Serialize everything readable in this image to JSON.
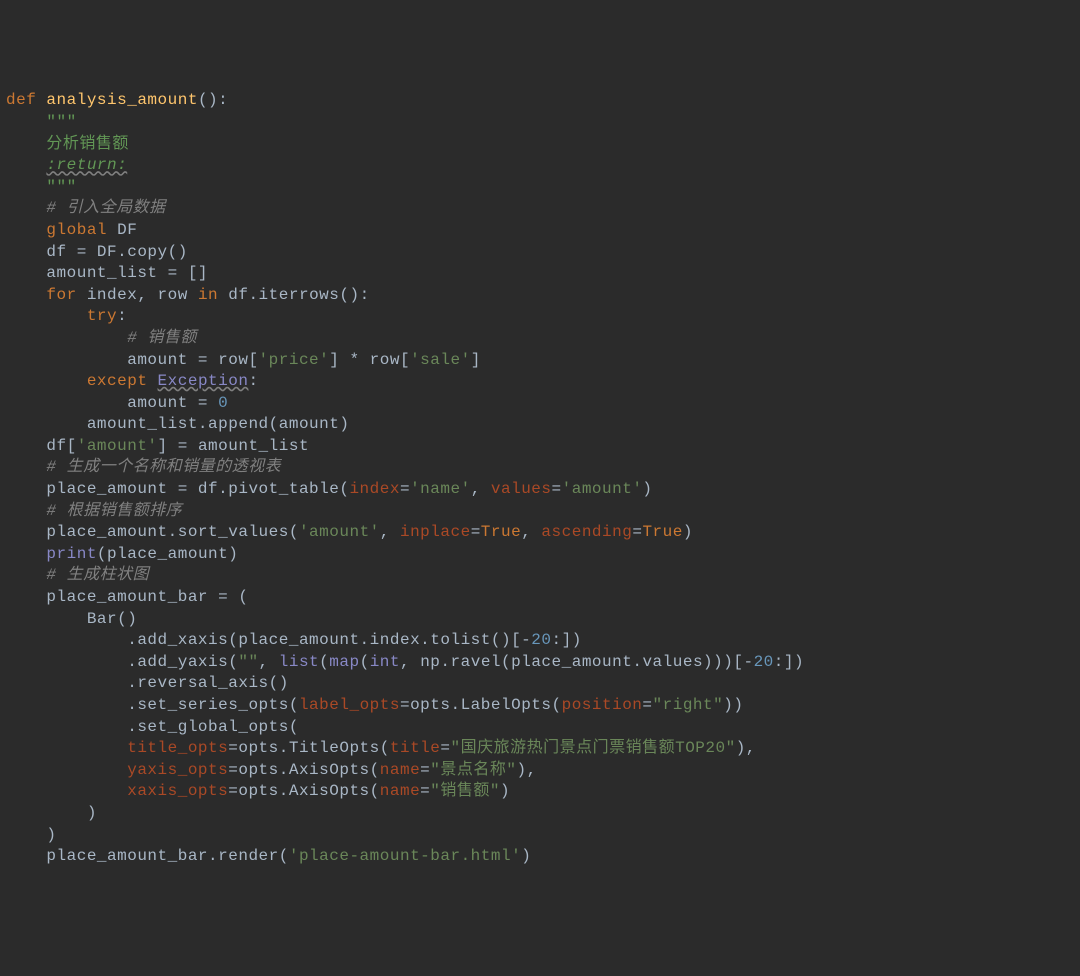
{
  "lines": [
    {
      "type": "code",
      "segments": [
        {
          "cls": "kw",
          "t": "def "
        },
        {
          "cls": "fn",
          "t": "analysis_amount"
        },
        {
          "cls": "plain",
          "t": "():"
        }
      ]
    },
    {
      "type": "code",
      "indent": 1,
      "segments": [
        {
          "cls": "docq",
          "t": "\"\"\""
        }
      ]
    },
    {
      "type": "code",
      "indent": 1,
      "segments": [
        {
          "cls": "doc",
          "t": "分析销售额"
        }
      ]
    },
    {
      "type": "code",
      "indent": 1,
      "segments": [
        {
          "cls": "ret",
          "t": ":return:"
        }
      ]
    },
    {
      "type": "code",
      "indent": 1,
      "segments": [
        {
          "cls": "docq",
          "t": "\"\"\""
        }
      ]
    },
    {
      "type": "code",
      "indent": 1,
      "segments": [
        {
          "cls": "com",
          "t": "# 引入全局数据"
        }
      ]
    },
    {
      "type": "code",
      "indent": 1,
      "segments": [
        {
          "cls": "kw",
          "t": "global "
        },
        {
          "cls": "plain",
          "t": "DF"
        }
      ]
    },
    {
      "type": "code",
      "indent": 1,
      "segments": [
        {
          "cls": "plain",
          "t": "df = DF.copy()"
        }
      ]
    },
    {
      "type": "code",
      "indent": 1,
      "segments": [
        {
          "cls": "plain",
          "t": "amount_list = []"
        }
      ]
    },
    {
      "type": "code",
      "indent": 1,
      "segments": [
        {
          "cls": "kw",
          "t": "for "
        },
        {
          "cls": "plain",
          "t": "index"
        },
        {
          "cls": "op",
          "t": ", "
        },
        {
          "cls": "plain",
          "t": "row "
        },
        {
          "cls": "kw",
          "t": "in "
        },
        {
          "cls": "plain",
          "t": "df.iterrows():"
        }
      ]
    },
    {
      "type": "code",
      "indent": 2,
      "segments": [
        {
          "cls": "kw",
          "t": "try"
        },
        {
          "cls": "plain",
          "t": ":"
        }
      ]
    },
    {
      "type": "code",
      "indent": 3,
      "segments": [
        {
          "cls": "com",
          "t": "# 销售额"
        }
      ]
    },
    {
      "type": "code",
      "indent": 3,
      "segments": [
        {
          "cls": "plain",
          "t": "amount = row["
        },
        {
          "cls": "str",
          "t": "'price'"
        },
        {
          "cls": "plain",
          "t": "] * row["
        },
        {
          "cls": "str",
          "t": "'sale'"
        },
        {
          "cls": "plain",
          "t": "]"
        }
      ]
    },
    {
      "type": "code",
      "indent": 2,
      "segments": [
        {
          "cls": "kw",
          "t": "except "
        },
        {
          "cls": "exc",
          "t": "Exception"
        },
        {
          "cls": "plain",
          "t": ":"
        }
      ]
    },
    {
      "type": "code",
      "indent": 3,
      "segments": [
        {
          "cls": "plain",
          "t": "amount = "
        },
        {
          "cls": "num",
          "t": "0"
        }
      ]
    },
    {
      "type": "code",
      "indent": 2,
      "segments": [
        {
          "cls": "plain",
          "t": "amount_list.append(amount)"
        }
      ]
    },
    {
      "type": "code",
      "indent": 1,
      "segments": [
        {
          "cls": "plain",
          "t": "df["
        },
        {
          "cls": "str",
          "t": "'amount'"
        },
        {
          "cls": "plain",
          "t": "] = amount_list"
        }
      ]
    },
    {
      "type": "code",
      "indent": 1,
      "segments": [
        {
          "cls": "com",
          "t": "# 生成一个名称和销量的透视表"
        }
      ]
    },
    {
      "type": "code",
      "indent": 1,
      "segments": [
        {
          "cls": "plain",
          "t": "place_amount = df.pivot_table("
        },
        {
          "cls": "param",
          "t": "index"
        },
        {
          "cls": "plain",
          "t": "="
        },
        {
          "cls": "str",
          "t": "'name'"
        },
        {
          "cls": "op",
          "t": ", "
        },
        {
          "cls": "param",
          "t": "values"
        },
        {
          "cls": "plain",
          "t": "="
        },
        {
          "cls": "str",
          "t": "'amount'"
        },
        {
          "cls": "plain",
          "t": ")"
        }
      ]
    },
    {
      "type": "code",
      "indent": 1,
      "segments": [
        {
          "cls": "com",
          "t": "# 根据销售额排序"
        }
      ]
    },
    {
      "type": "code",
      "indent": 1,
      "segments": [
        {
          "cls": "plain",
          "t": "place_amount.sort_values("
        },
        {
          "cls": "str",
          "t": "'amount'"
        },
        {
          "cls": "op",
          "t": ", "
        },
        {
          "cls": "param",
          "t": "inplace"
        },
        {
          "cls": "plain",
          "t": "="
        },
        {
          "cls": "bool",
          "t": "True"
        },
        {
          "cls": "op",
          "t": ", "
        },
        {
          "cls": "param",
          "t": "ascending"
        },
        {
          "cls": "plain",
          "t": "="
        },
        {
          "cls": "bool",
          "t": "True"
        },
        {
          "cls": "plain",
          "t": ")"
        }
      ]
    },
    {
      "type": "code",
      "indent": 1,
      "segments": [
        {
          "cls": "builtin",
          "t": "print"
        },
        {
          "cls": "plain",
          "t": "(place_amount)"
        }
      ]
    },
    {
      "type": "code",
      "indent": 1,
      "segments": [
        {
          "cls": "com",
          "t": "# 生成柱状图"
        }
      ]
    },
    {
      "type": "code",
      "indent": 1,
      "segments": [
        {
          "cls": "plain",
          "t": "place_amount_bar = ("
        }
      ]
    },
    {
      "type": "code",
      "indent": 2,
      "segments": [
        {
          "cls": "plain",
          "t": "Bar()"
        }
      ]
    },
    {
      "type": "code",
      "indent": 3,
      "segments": [
        {
          "cls": "plain",
          "t": ".add_xaxis(place_amount.index.tolist()[-"
        },
        {
          "cls": "num",
          "t": "20"
        },
        {
          "cls": "plain",
          "t": ":])"
        }
      ]
    },
    {
      "type": "code",
      "indent": 3,
      "segments": [
        {
          "cls": "plain",
          "t": ".add_yaxis("
        },
        {
          "cls": "str",
          "t": "\"\""
        },
        {
          "cls": "op",
          "t": ", "
        },
        {
          "cls": "builtin",
          "t": "list"
        },
        {
          "cls": "plain",
          "t": "("
        },
        {
          "cls": "builtin",
          "t": "map"
        },
        {
          "cls": "plain",
          "t": "("
        },
        {
          "cls": "builtin",
          "t": "int"
        },
        {
          "cls": "op",
          "t": ", "
        },
        {
          "cls": "plain",
          "t": "np.ravel(place_amount.values)))[-"
        },
        {
          "cls": "num",
          "t": "20"
        },
        {
          "cls": "plain",
          "t": ":])"
        }
      ]
    },
    {
      "type": "code",
      "indent": 3,
      "segments": [
        {
          "cls": "plain",
          "t": ".reversal_axis()"
        }
      ]
    },
    {
      "type": "code",
      "indent": 3,
      "segments": [
        {
          "cls": "plain",
          "t": ".set_series_opts("
        },
        {
          "cls": "param",
          "t": "label_opts"
        },
        {
          "cls": "plain",
          "t": "=opts.LabelOpts("
        },
        {
          "cls": "param",
          "t": "position"
        },
        {
          "cls": "plain",
          "t": "="
        },
        {
          "cls": "str",
          "t": "\"right\""
        },
        {
          "cls": "plain",
          "t": "))"
        }
      ]
    },
    {
      "type": "code",
      "indent": 3,
      "segments": [
        {
          "cls": "plain",
          "t": ".set_global_opts("
        }
      ]
    },
    {
      "type": "code",
      "indent": 3,
      "segments": [
        {
          "cls": "param",
          "t": "title_opts"
        },
        {
          "cls": "plain",
          "t": "=opts.TitleOpts("
        },
        {
          "cls": "param",
          "t": "title"
        },
        {
          "cls": "plain",
          "t": "="
        },
        {
          "cls": "str",
          "t": "\"国庆旅游热门景点门票销售额TOP20\""
        },
        {
          "cls": "plain",
          "t": "),"
        }
      ]
    },
    {
      "type": "code",
      "indent": 3,
      "segments": [
        {
          "cls": "param",
          "t": "yaxis_opts"
        },
        {
          "cls": "plain",
          "t": "=opts.AxisOpts("
        },
        {
          "cls": "param",
          "t": "name"
        },
        {
          "cls": "plain",
          "t": "="
        },
        {
          "cls": "str",
          "t": "\"景点名称\""
        },
        {
          "cls": "plain",
          "t": "),"
        }
      ]
    },
    {
      "type": "code",
      "indent": 3,
      "segments": [
        {
          "cls": "param",
          "t": "xaxis_opts"
        },
        {
          "cls": "plain",
          "t": "=opts.AxisOpts("
        },
        {
          "cls": "param",
          "t": "name"
        },
        {
          "cls": "plain",
          "t": "="
        },
        {
          "cls": "str",
          "t": "\"销售额\""
        },
        {
          "cls": "plain",
          "t": ")"
        }
      ]
    },
    {
      "type": "code",
      "indent": 2,
      "segments": [
        {
          "cls": "plain",
          "t": ")"
        }
      ]
    },
    {
      "type": "code",
      "indent": 1,
      "segments": [
        {
          "cls": "plain",
          "t": ")"
        }
      ]
    },
    {
      "type": "code",
      "indent": 1,
      "segments": [
        {
          "cls": "plain",
          "t": "place_amount_bar.render("
        },
        {
          "cls": "str",
          "t": "'place-amount-bar.html'"
        },
        {
          "cls": "plain",
          "t": ")"
        }
      ]
    }
  ],
  "indent_unit": "    "
}
